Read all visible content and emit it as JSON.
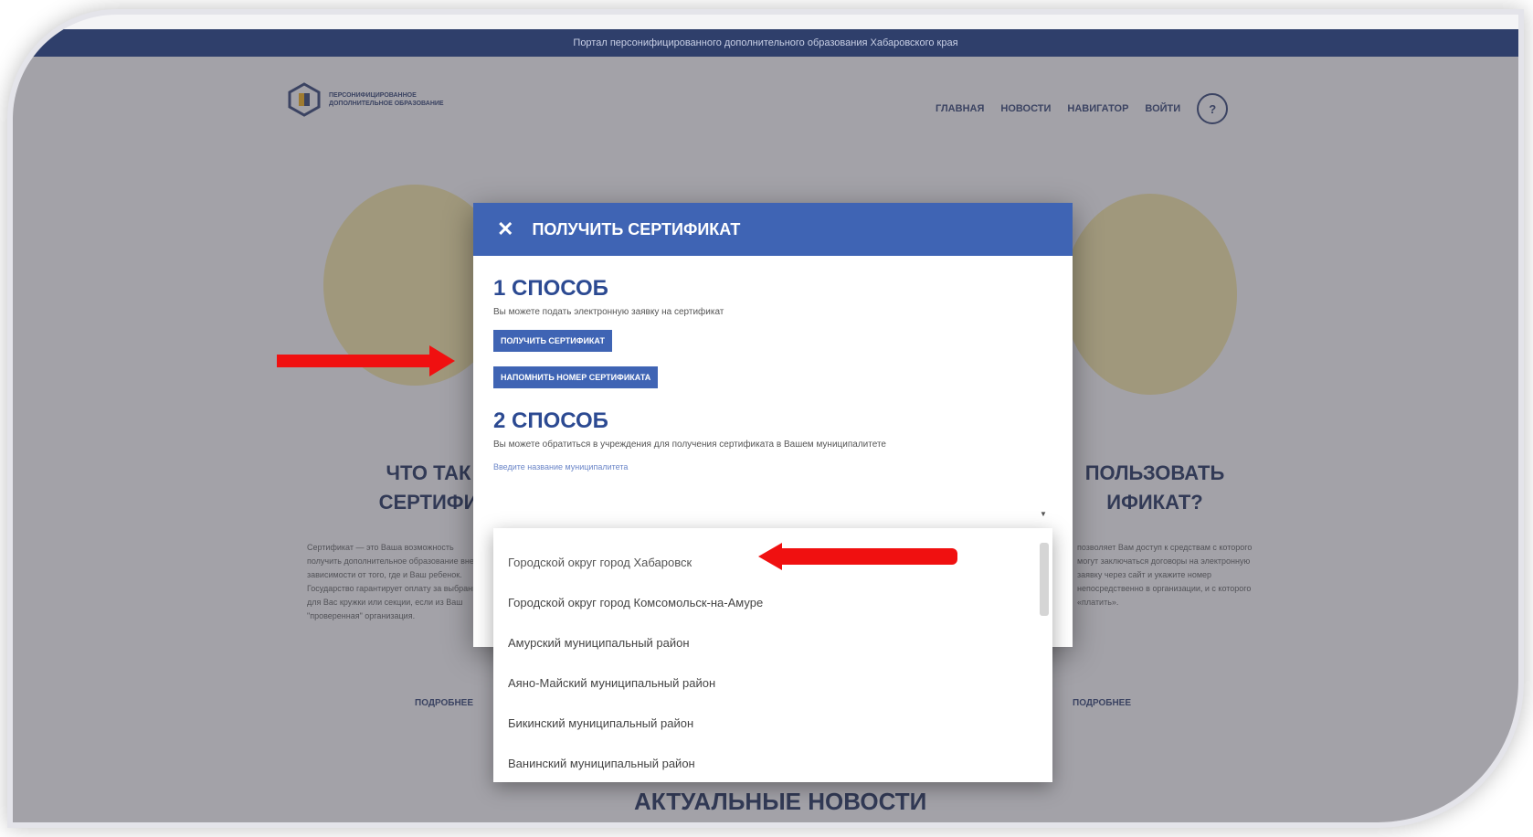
{
  "portal_banner": "Портал персонифицированного дополнительного образования Хабаровского края",
  "logo": {
    "text": "Персонифицированное дополнительное образование"
  },
  "nav": {
    "items": [
      "ГЛАВНАЯ",
      "НОВОСТИ",
      "НАВИГАТОР",
      "ВОЙТИ"
    ],
    "help": "?"
  },
  "sections": {
    "left_title_line1": "ЧТО ТАК",
    "left_title_line2": "СЕРТИФИ",
    "right_title_line1": "ПОЛЬЗОВАТЬ",
    "right_title_line2": "ИФИКАТ?",
    "left_text": "Сертификат — это Ваша возможность получить дополнительное образование вне зависимости от того, где и Ваш ребенок. Государство гарантирует оплату за выбранные для Вас кружки или секции, если из Ваш \"проверенная\" организация.",
    "right_text": "позволяет Вам доступ к средствам с которого могут заключаться договоры на электронную заявку через сайт и укажите номер непосредственно в организации, и с которого «платить».",
    "left_more": "ПОДРОБНЕЕ",
    "right_more": "ПОДРОБНЕЕ",
    "news_title": "АКТУАЛЬНЫЕ НОВОСТИ"
  },
  "modal": {
    "close_icon": "✕",
    "title": "ПОЛУЧИТЬ СЕРТИФИКАТ",
    "way1_title": "1 СПОСОБ",
    "way1_desc": "Вы можете подать электронную заявку на сертификат",
    "btn_get": "ПОЛУЧИТЬ СЕРТИФИКАТ",
    "btn_remind": "НАПОМНИТЬ НОМЕР СЕРТИФИКАТА",
    "way2_title": "2 СПОСОБ",
    "way2_desc": "Вы можете обратиться в учреждения для получения сертификата в Вашем муниципалитете",
    "select_label": "Введите название муниципалитета"
  },
  "dropdown": {
    "options": [
      "Городской округ город Хабаровск",
      "Городской округ город Комсомольск-на-Амуре",
      "Амурский муниципальный район",
      "Аяно-Майский муниципальный район",
      "Бикинский муниципальный район",
      "Ванинский муниципальный район"
    ]
  },
  "colors": {
    "accent": "#3f64b4",
    "dark_navy": "#2f3f6b",
    "arrow": "#f01010"
  }
}
